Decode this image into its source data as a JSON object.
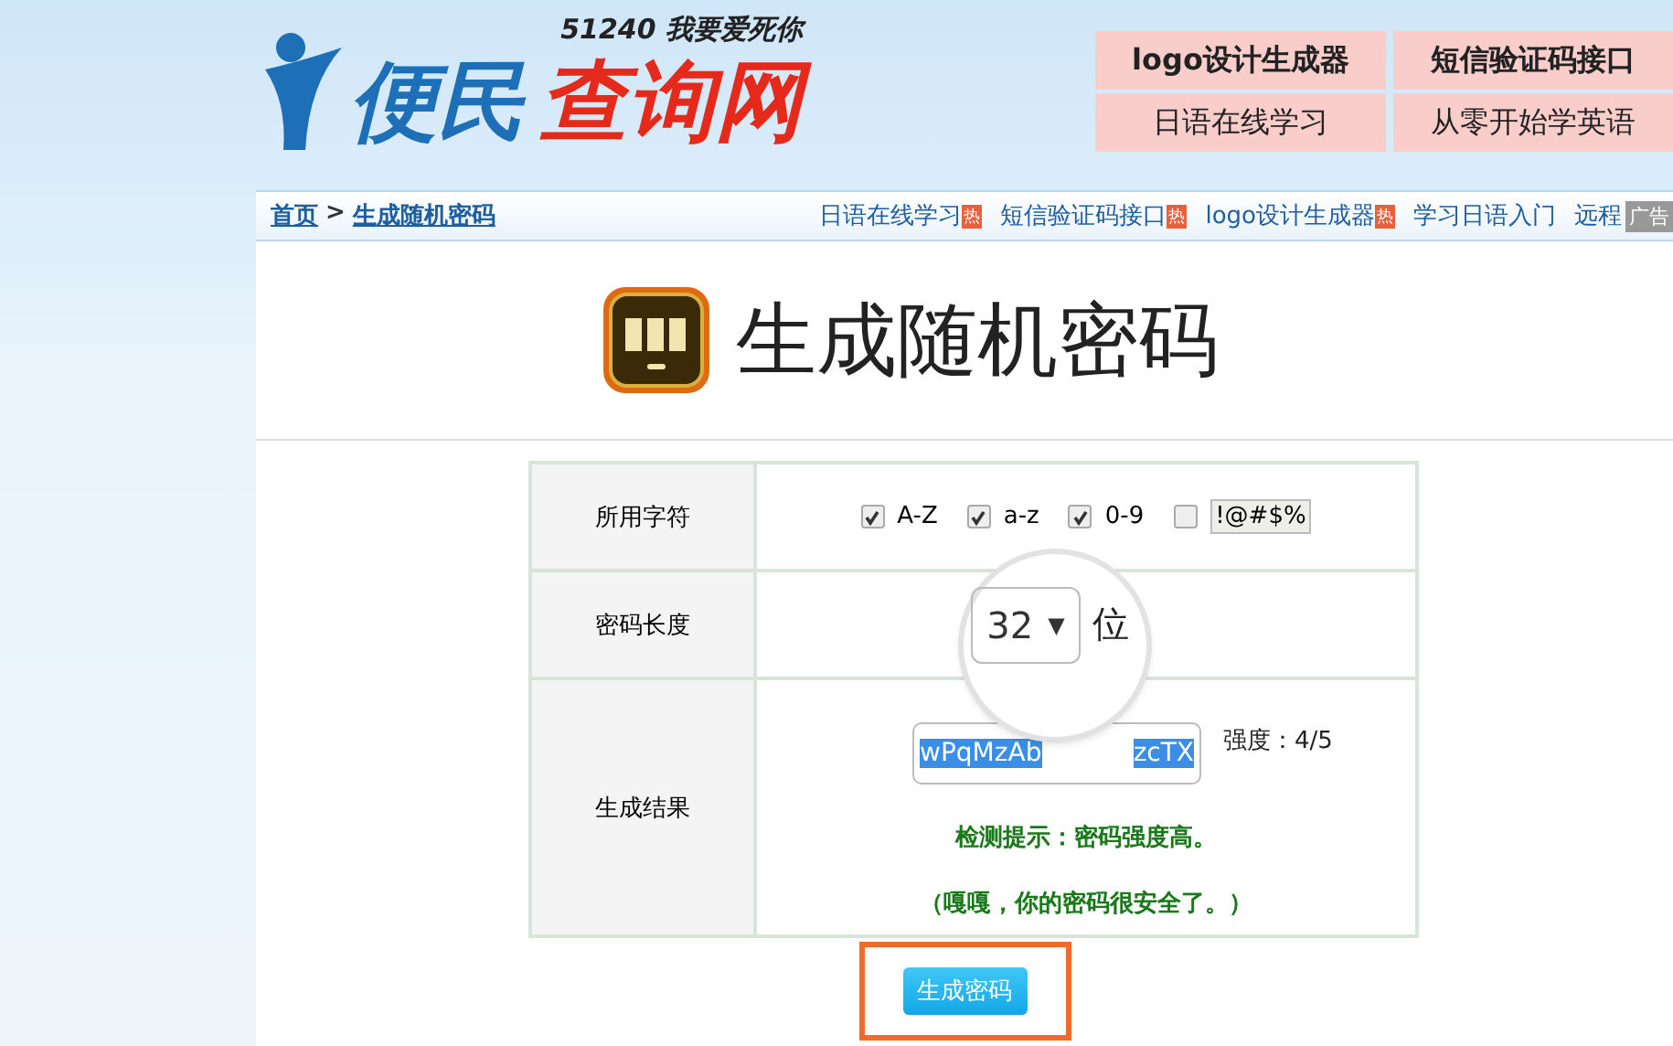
{
  "logo": {
    "slogan": "51240 我要爱死你",
    "name_blue": "便民",
    "name_red": "查询网"
  },
  "header_links_top": [
    "logo设计生成器",
    "短信验证码接口"
  ],
  "header_links_bottom": [
    "日语在线学习",
    "从零开始学英语"
  ],
  "breadcrumb": {
    "home": "首页",
    "separator": ">",
    "current": "生成随机密码"
  },
  "nav_links": [
    {
      "label": "日语在线学习",
      "hot_badge": "热"
    },
    {
      "label": "短信验证码接口",
      "hot_badge": "热"
    },
    {
      "label": "logo设计生成器",
      "hot_badge": "热"
    },
    {
      "label": "学习日语入门"
    },
    {
      "label": "远程"
    }
  ],
  "ad_badge": "广告",
  "page_title": "生成随机密码",
  "form": {
    "charset_label": "所用字符",
    "charsets": [
      {
        "label": "A-Z",
        "checked": true,
        "kind": "plain"
      },
      {
        "label": "a-z",
        "checked": true,
        "kind": "plain"
      },
      {
        "label": "0-9",
        "checked": true,
        "kind": "plain"
      },
      {
        "label": "!@#$%",
        "checked": false,
        "kind": "boxed"
      }
    ],
    "length_label": "密码长度",
    "length_value": "32",
    "length_caret": "▼",
    "length_unit": "位",
    "result_label": "生成结果",
    "result_start": "wPqMzAb",
    "result_end": "zcTX",
    "strength": "强度：4/5",
    "hint": "检测提示：密码强度高。",
    "hint2": "（嘎嘎，你的密码很安全了。）"
  },
  "generate_button": "生成密码"
}
